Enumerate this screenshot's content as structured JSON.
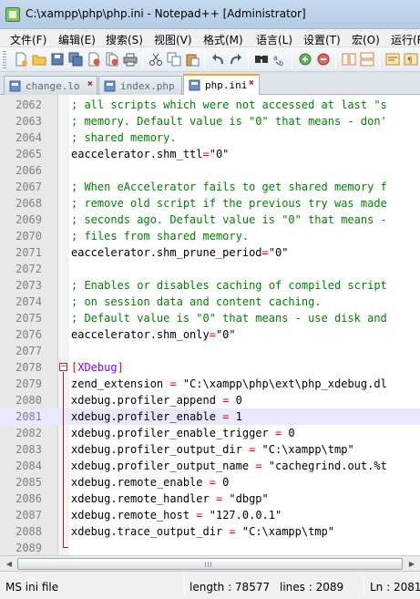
{
  "window": {
    "title": "C:\\xampp\\php\\php.ini - Notepad++ [Administrator]"
  },
  "menu": [
    "文件(F)",
    "编辑(E)",
    "搜索(S)",
    "视图(V)",
    "格式(M)",
    "语言(L)",
    "设置(T)",
    "宏(O)",
    "运行(R)"
  ],
  "toolbar": {
    "buttons": [
      "new-file-icon",
      "open-file-icon",
      "save-icon",
      "save-all-icon",
      "close-icon",
      "close-all-icon",
      "print-icon",
      "cut-icon",
      "copy-icon",
      "paste-icon",
      "undo-icon",
      "redo-icon",
      "find-icon",
      "replace-icon",
      "zoom-in-icon",
      "zoom-out-icon",
      "sync-vertical-icon",
      "sync-horizontal-icon"
    ]
  },
  "tabs": [
    {
      "label": "change.lo",
      "active": false
    },
    {
      "label": "index.php",
      "active": false
    },
    {
      "label": "php.ini",
      "active": true
    }
  ],
  "editor": {
    "current_line": "2081",
    "lines": [
      {
        "n": "2062",
        "kind": "comment",
        "text": "; all scripts which were not accessed at last \"s"
      },
      {
        "n": "2063",
        "kind": "comment",
        "text": "; memory. Default value is \"0\" that means - don'"
      },
      {
        "n": "2064",
        "kind": "comment",
        "text": "; shared memory."
      },
      {
        "n": "2065",
        "kind": "kv",
        "key": "eaccelerator.shm_ttl",
        "op": "=",
        "val": "\"0\""
      },
      {
        "n": "2066",
        "kind": "blank",
        "text": ""
      },
      {
        "n": "2067",
        "kind": "comment",
        "text": "; When eAccelerator fails to get shared memory f"
      },
      {
        "n": "2068",
        "kind": "comment",
        "text": "; remove old script if the previous try was made"
      },
      {
        "n": "2069",
        "kind": "comment",
        "text": "; seconds ago. Default value is \"0\" that means -"
      },
      {
        "n": "2070",
        "kind": "comment",
        "text": "; files from shared memory."
      },
      {
        "n": "2071",
        "kind": "kv",
        "key": "eaccelerator.shm_prune_period",
        "op": "=",
        "val": "\"0\""
      },
      {
        "n": "2072",
        "kind": "blank",
        "text": ""
      },
      {
        "n": "2073",
        "kind": "comment",
        "text": "; Enables or disables caching of compiled script"
      },
      {
        "n": "2074",
        "kind": "comment",
        "text": "; on session data and content caching."
      },
      {
        "n": "2075",
        "kind": "comment",
        "text": "; Default value is \"0\" that means - use disk and"
      },
      {
        "n": "2076",
        "kind": "kv",
        "key": "eaccelerator.shm_only",
        "op": "=",
        "val": "\"0\""
      },
      {
        "n": "2077",
        "kind": "blank",
        "text": ""
      },
      {
        "n": "2078",
        "kind": "section",
        "text": "XDebug"
      },
      {
        "n": "2079",
        "kind": "kv",
        "key": "zend_extension ",
        "op": "=",
        "val": " \"C:\\xampp\\php\\ext\\php_xdebug.dl"
      },
      {
        "n": "2080",
        "kind": "kv",
        "key": "xdebug.profiler_append ",
        "op": "=",
        "val": " 0"
      },
      {
        "n": "2081",
        "kind": "kv",
        "key": "xdebug.profiler_enable ",
        "op": "=",
        "val": " 1"
      },
      {
        "n": "2082",
        "kind": "kv",
        "key": "xdebug.profiler_enable_trigger ",
        "op": "=",
        "val": " 0"
      },
      {
        "n": "2083",
        "kind": "kv",
        "key": "xdebug.profiler_output_dir ",
        "op": "=",
        "val": " \"C:\\xampp\\tmp\""
      },
      {
        "n": "2084",
        "kind": "kv",
        "key": "xdebug.profiler_output_name ",
        "op": "=",
        "val": " \"cachegrind.out.%t"
      },
      {
        "n": "2085",
        "kind": "kv",
        "key": "xdebug.remote_enable ",
        "op": "=",
        "val": " 0"
      },
      {
        "n": "2086",
        "kind": "kv",
        "key": "xdebug.remote_handler ",
        "op": "=",
        "val": " \"dbgp\""
      },
      {
        "n": "2087",
        "kind": "kv",
        "key": "xdebug.remote_host ",
        "op": "=",
        "val": " \"127.0.0.1\""
      },
      {
        "n": "2088",
        "kind": "kv",
        "key": "xdebug.trace_output_dir ",
        "op": "=",
        "val": " \"C:\\xampp\\tmp\""
      },
      {
        "n": "2089",
        "kind": "blank",
        "text": ""
      }
    ]
  },
  "status": {
    "file_type": "MS ini file",
    "length": "length : 78577",
    "lines": "lines : 2089",
    "position": "Ln : 2081"
  },
  "colors": {
    "comment": "#008000",
    "operator": "#ff0000",
    "section": "#8000ff",
    "current_line": "#e8e8ff",
    "active_tab_accent": "#f5a623"
  }
}
